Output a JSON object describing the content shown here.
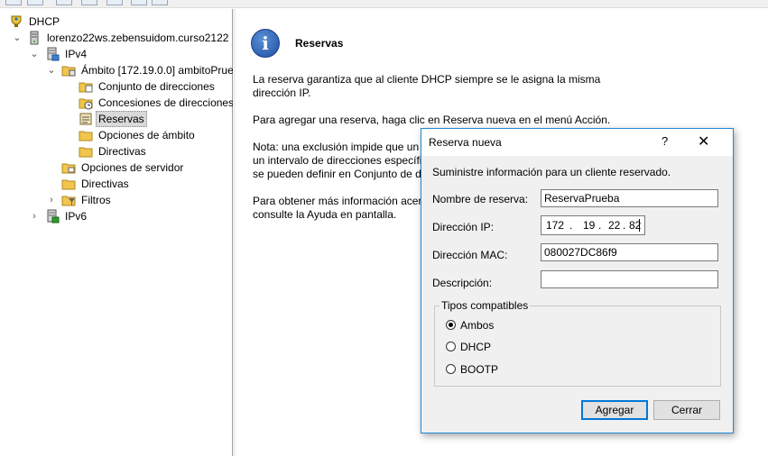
{
  "tree": {
    "root": "DHCP",
    "server": "lorenzo22ws.zebensuidom.curso2122",
    "ipv4": "IPv4",
    "scope": "Ámbito [172.19.0.0] ambitoPrue",
    "address_pool": "Conjunto de direcciones",
    "leases": "Concesiones de direcciones",
    "reservations": "Reservas",
    "scope_options": "Opciones de ámbito",
    "scope_policies": "Directivas",
    "server_options": "Opciones de servidor",
    "policies": "Directivas",
    "filters": "Filtros",
    "ipv6": "IPv6"
  },
  "right": {
    "title": "Reservas",
    "p1_line1": "La reserva garantiza que al cliente DHCP siempre se le asigna la misma",
    "p1_line2": "dirección IP.",
    "p2": "Para agregar una reserva, haga clic en Reserva nueva en el menú Acción.",
    "p3_line1": "Nota: una exclusión impide que un",
    "p3_line2": "un intervalo de direcciones específic",
    "p3_line3": "se pueden definir en Conjunto de d",
    "p4_line1": "Para obtener más información acerc",
    "p4_line2": "consulte la Ayuda en pantalla."
  },
  "dialog": {
    "title": "Reserva nueva",
    "help": "?",
    "close": "✕",
    "intro": "Suministre información para un cliente reservado.",
    "name_label": "Nombre de reserva:",
    "name_value": "ReservaPrueba",
    "ip_label": "Dirección IP:",
    "ip_octets": [
      "172",
      "19",
      "22",
      "82"
    ],
    "ip_dot": ".",
    "mac_label": "Dirección MAC:",
    "mac_value": "080027DC86f9",
    "desc_label": "Descripción:",
    "desc_value": "",
    "group_label": "Tipos compatibles",
    "options": [
      {
        "label": "Ambos",
        "selected": true
      },
      {
        "label": "DHCP",
        "selected": false
      },
      {
        "label": "BOOTP",
        "selected": false
      }
    ],
    "add_button": "Agregar",
    "cancel_button": "Cerrar"
  },
  "colors": {
    "dialog_border": "#1e88d4",
    "selection": "#d9d9d9",
    "default_button": "#0078d7"
  }
}
